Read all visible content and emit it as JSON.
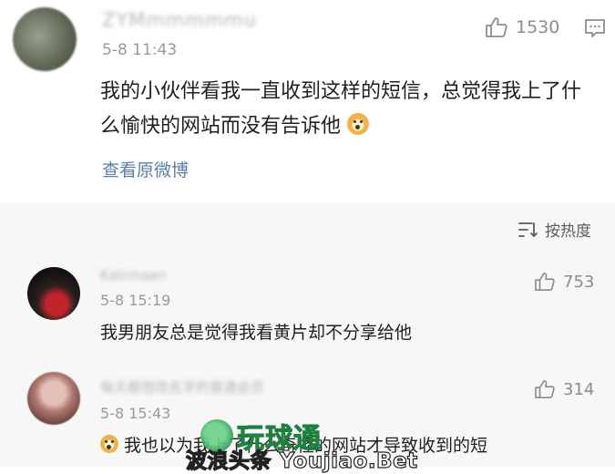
{
  "post": {
    "username": "ZYMmmmmmu",
    "time": "5-8 11:43",
    "text": "我的小伙伴看我一直收到这样的短信，总觉得我上了什么愉快的网站而没有告诉他",
    "link_label": "查看原微博",
    "likes": "1530",
    "icons": {
      "like": "thumbs-up-icon",
      "comment": "comment-icon"
    }
  },
  "sort": {
    "label": "按热度",
    "icon": "sort-icon"
  },
  "comments": [
    {
      "username": "Katrinaan",
      "time": "5-8 15:19",
      "text": "我男朋友总是觉得我看黄片却不分享给他",
      "likes": "753"
    },
    {
      "username": "每天都想改名字的普通会员",
      "time": "5-8 15:43",
      "text": "我也以为我上了什么奇怪的网站才导致收到的短",
      "likes": "314"
    }
  ],
  "watermark": {
    "brand_cn": "玩球通",
    "url": "波浪头条 Youjiao.Bet"
  },
  "colors": {
    "link": "#5a7ea8",
    "meta": "#9a9a9a",
    "section_bg": "#f7f7f7",
    "text": "#1f1f1f"
  }
}
